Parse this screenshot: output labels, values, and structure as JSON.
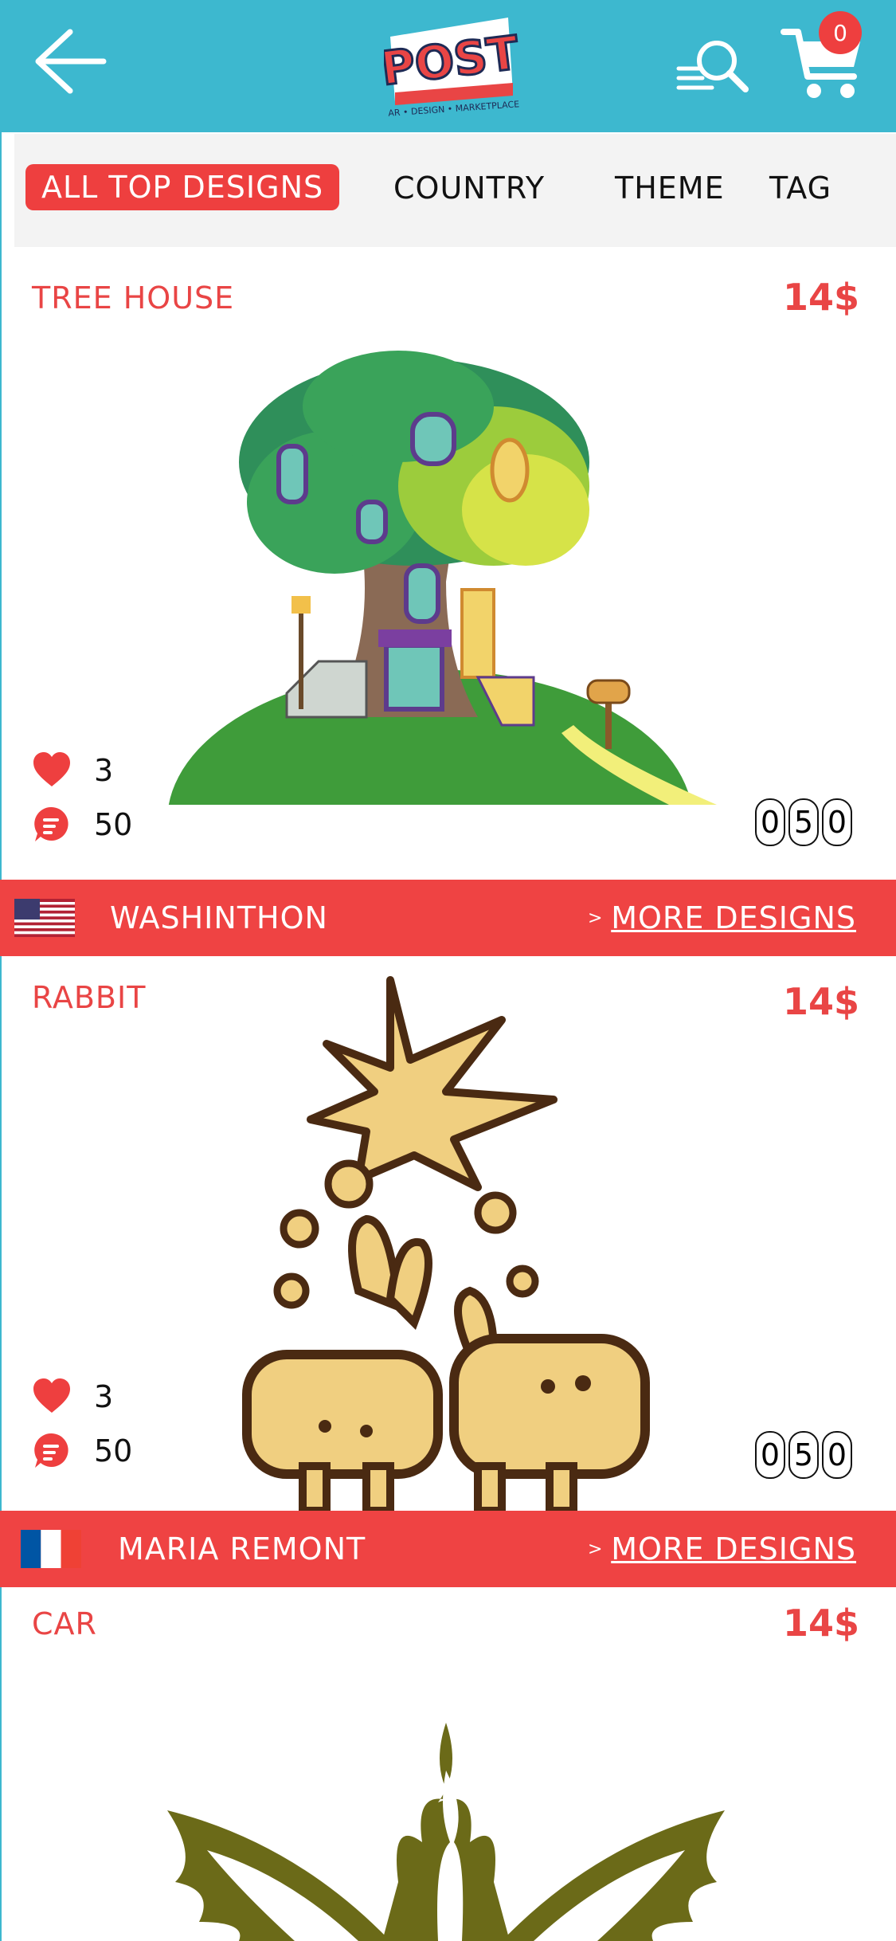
{
  "header": {
    "logo_text": "POST",
    "logo_tagline": "AR • DESIGN • MARKETPLACE",
    "cart_count": "0"
  },
  "tabs": [
    {
      "label": "ALL TOP DESIGNS",
      "active": true
    },
    {
      "label": "COUNTRY",
      "active": false
    },
    {
      "label": "THEME",
      "active": false
    },
    {
      "label": "TAG",
      "active": false
    }
  ],
  "colors": {
    "header_bg": "#3db8cf",
    "accent_red": "#ef4343",
    "title_red": "#e94545"
  },
  "cards": [
    {
      "title": "TREE HOUSE",
      "price": "14$",
      "likes": "3",
      "comments": "50",
      "counter": [
        "0",
        "5",
        "0"
      ],
      "flag": "us-flag-icon",
      "designer": "WASHINTHON",
      "more_chevron": ">",
      "more_label": "MORE DESIGNS"
    },
    {
      "title": "RABBIT",
      "price": "14$",
      "likes": "3",
      "comments": "50",
      "counter": [
        "0",
        "5",
        "0"
      ],
      "flag": "france-flag-icon",
      "designer": "MARIA REMONT",
      "more_chevron": ">",
      "more_label": "MORE DESIGNS"
    },
    {
      "title": "CAR",
      "price": "14$"
    }
  ]
}
